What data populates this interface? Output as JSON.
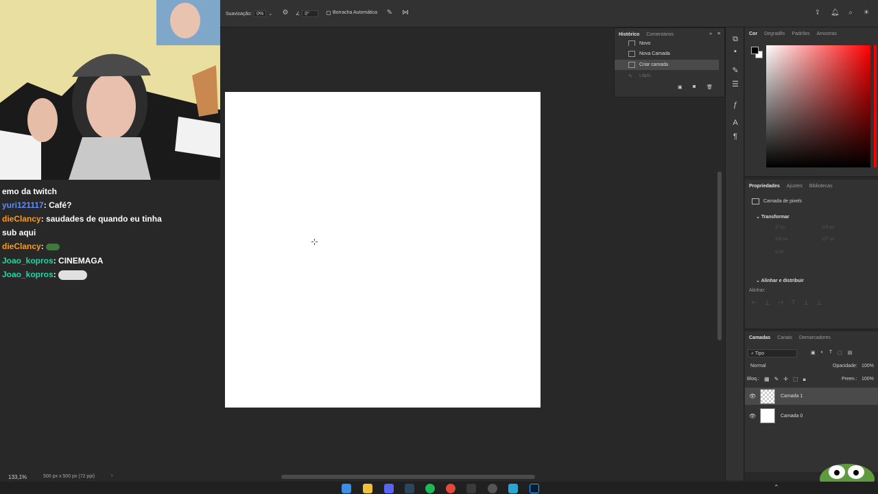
{
  "options_bar": {
    "smoothing_label": "Suavização:",
    "smoothing_value": "0%",
    "angle_value": "0°",
    "auto_erase_label": "Borracha Automática"
  },
  "chat": {
    "partial_line": "emo da twitch",
    "messages": [
      {
        "user": "yuri121117",
        "text": "Café?",
        "color": "#5a8dff"
      },
      {
        "user": "dieClancy",
        "text": "saudades de quando eu tinha",
        "color": "#ff9b1a"
      },
      {
        "user": "",
        "text": "sub aqui",
        "color": ""
      },
      {
        "user": "dieClancy",
        "text": "",
        "color": "#ff9b1a"
      },
      {
        "user": "Joao_kopros",
        "text": "CINEMAGA",
        "color": "#1fd6a4"
      },
      {
        "user": "Joao_kopros",
        "text": "",
        "color": "#1fd6a4"
      }
    ]
  },
  "history_panel": {
    "tabs": [
      "Histórico",
      "Comentários"
    ],
    "items": [
      {
        "label": "Novo"
      },
      {
        "label": "Nova Camada"
      },
      {
        "label": "Criar camada",
        "selected": true
      },
      {
        "label": "Lápis",
        "dim": true
      }
    ]
  },
  "color_panel": {
    "tabs": [
      "Cor",
      "Degradês",
      "Padrões",
      "Amostras"
    ],
    "foreground": "#000000",
    "background": "#ffffff"
  },
  "properties_panel": {
    "tabs": [
      "Propriedades",
      "Ajustes",
      "Bibliotecas"
    ],
    "layer_type": "Camada de pixels",
    "transform_label": "Transformar",
    "transform_values": {
      "w": "27 px",
      "h": "105 px",
      "x": "125 px",
      "y": "157 px",
      "angle": "0,00°"
    },
    "align_label": "Alinhar e distribuir",
    "align_sub": "Alinhar:"
  },
  "layers_panel": {
    "tabs": [
      "Camadas",
      "Canais",
      "Demarcadores"
    ],
    "filter_kind": "Tipo",
    "blend_mode": "Normal",
    "opacity_label": "Opacidade:",
    "opacity_value": "100%",
    "lock_label": "Bloq.:",
    "fill_label": "Preen.:",
    "fill_value": "100%",
    "layers": [
      {
        "name": "Camada 1",
        "selected": true
      },
      {
        "name": "Camada 0",
        "selected": false
      }
    ]
  },
  "status": {
    "zoom": "133,1%",
    "doc_info": "500 px x 500 px (72 ppi)"
  }
}
